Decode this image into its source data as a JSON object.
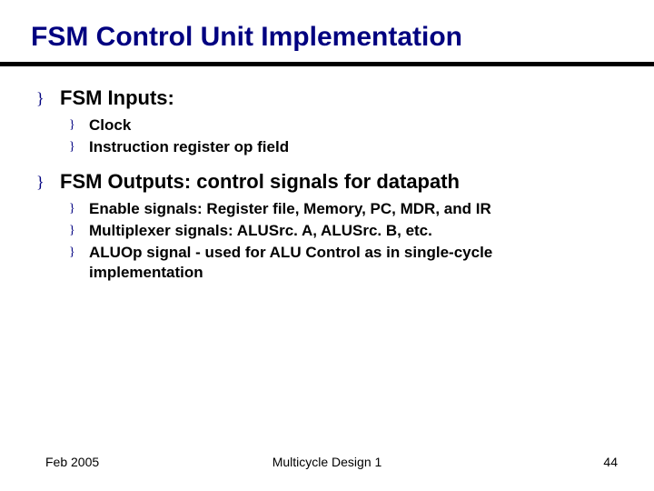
{
  "title": "FSM Control Unit Implementation",
  "bullets": {
    "b1": {
      "glyph": "}",
      "text": "FSM Inputs:"
    },
    "b1_1": {
      "glyph": "}",
      "text": "Clock"
    },
    "b1_2": {
      "glyph": "}",
      "text": "Instruction register op field"
    },
    "b2": {
      "glyph": "}",
      "text": "FSM Outputs: control signals for datapath"
    },
    "b2_1": {
      "glyph": "}",
      "text": "Enable signals: Register file, Memory, PC, MDR, and IR"
    },
    "b2_2": {
      "glyph": "}",
      "text": "Multiplexer signals: ALUSrc. A, ALUSrc. B, etc."
    },
    "b2_3": {
      "glyph": "}",
      "text": "ALUOp signal - used for ALU Control as in single-cycle implementation"
    }
  },
  "footer": {
    "left": "Feb 2005",
    "center": "Multicycle Design 1",
    "right": "44"
  }
}
